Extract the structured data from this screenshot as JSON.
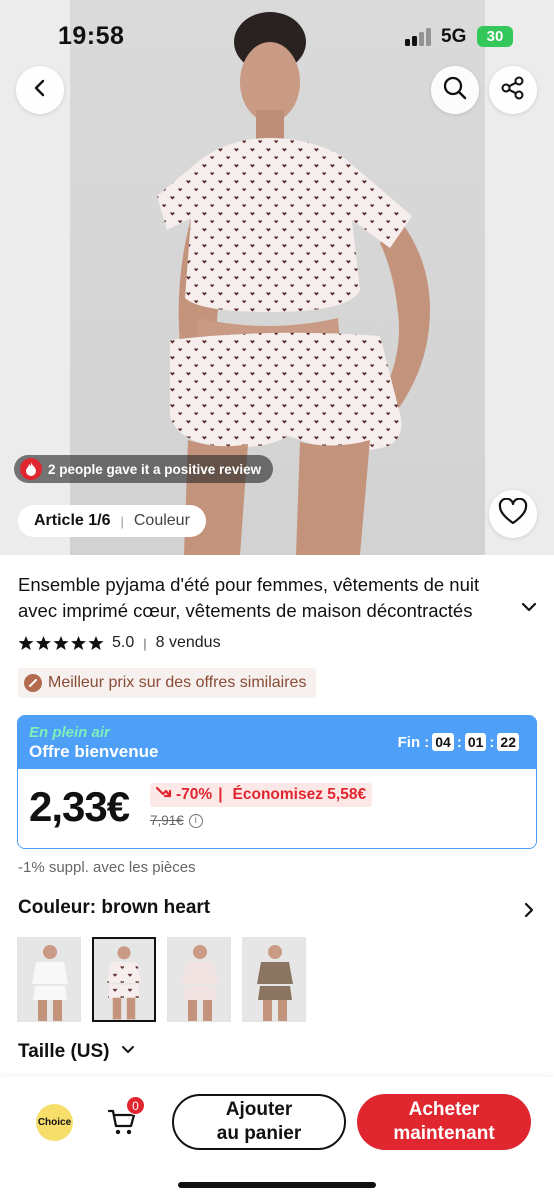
{
  "status": {
    "time": "19:58",
    "network": "5G",
    "battery": "30"
  },
  "hero": {
    "back_icon": "chevron-left-icon",
    "search_icon": "search-icon",
    "share_icon": "share-icon",
    "review_text": "2 people gave it a positive review",
    "article_label": "Article 1/6",
    "article_color": "Couleur",
    "wishlist_icon": "heart-outline-icon"
  },
  "product": {
    "title_line1": "Ensemble pyjama d'été pour femmes, vêtements de nuit",
    "title_line2": "avec imprimé cœur, vêtements de maison décontractés",
    "rating": "5.0",
    "sold": "8 vendus",
    "best_price_badge": "Meilleur prix sur des offres similaires"
  },
  "offer": {
    "tag": "En plein air",
    "name": "Offre bienvenue",
    "countdown_label": "Fin :",
    "countdown": [
      "04",
      "01",
      "22"
    ],
    "price": "2,33€",
    "discount": "-70%",
    "savings": "Économisez 5,58€",
    "old_price": "7,91€"
  },
  "coins_text": "-1% suppl. avec les pièces",
  "color": {
    "label": "Couleur: brown heart",
    "thumbnails": [
      "white",
      "brown heart",
      "red heart",
      "leopard"
    ],
    "selected_index": 1
  },
  "size": {
    "label": "Taille (US)"
  },
  "bottom": {
    "choice_label": "Choice",
    "cart_count": "0",
    "add_to_cart_line1": "Ajouter",
    "add_to_cart_line2": "au panier",
    "buy_now_line1": "Acheter",
    "buy_now_line2": "maintenant"
  },
  "colors": {
    "accent_red": "#e0262f",
    "offer_blue": "#4d9ff7",
    "offer_tag_green": "#7ef0b8",
    "choice_yellow": "#f7de6a"
  }
}
